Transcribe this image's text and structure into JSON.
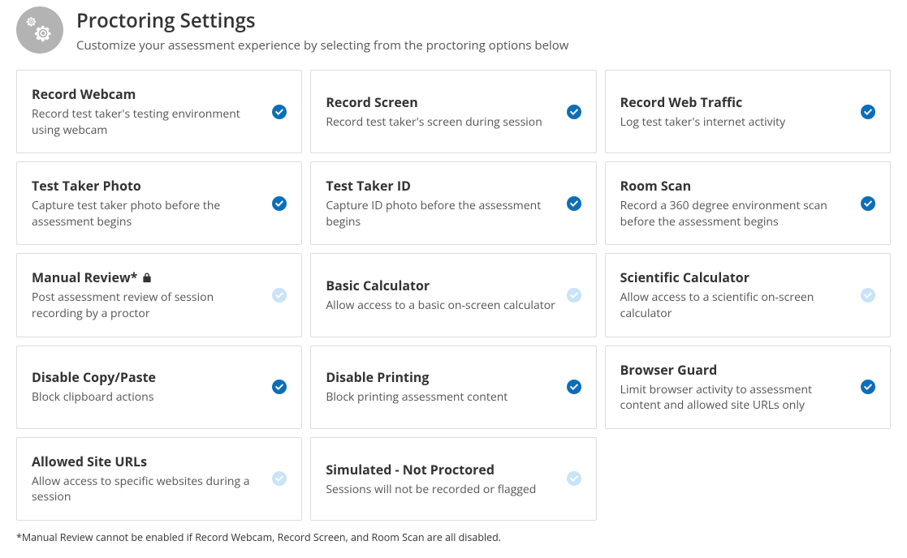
{
  "header": {
    "title": "Proctoring Settings",
    "subtitle": "Customize your assessment experience by selecting from the proctoring options below"
  },
  "cards": [
    {
      "id": "record-webcam",
      "title": "Record Webcam",
      "desc": "Record test taker's testing environment using webcam",
      "enabled": true,
      "locked": false
    },
    {
      "id": "record-screen",
      "title": "Record Screen",
      "desc": "Record test taker's screen during session",
      "enabled": true,
      "locked": false
    },
    {
      "id": "record-web-traffic",
      "title": "Record Web Traffic",
      "desc": "Log test taker's internet activity",
      "enabled": true,
      "locked": false
    },
    {
      "id": "test-taker-photo",
      "title": "Test Taker Photo",
      "desc": "Capture test taker photo before the assessment begins",
      "enabled": true,
      "locked": false
    },
    {
      "id": "test-taker-id",
      "title": "Test Taker ID",
      "desc": "Capture ID photo before the assessment begins",
      "enabled": true,
      "locked": false
    },
    {
      "id": "room-scan",
      "title": "Room Scan",
      "desc": "Record a 360 degree environment scan before the assessment begins",
      "enabled": true,
      "locked": false
    },
    {
      "id": "manual-review",
      "title": "Manual Review*",
      "desc": "Post assessment review of session recording by a proctor",
      "enabled": false,
      "locked": true
    },
    {
      "id": "basic-calculator",
      "title": "Basic Calculator",
      "desc": "Allow access to a basic on-screen calculator",
      "enabled": false,
      "locked": false
    },
    {
      "id": "scientific-calculator",
      "title": "Scientific Calculator",
      "desc": "Allow access to a scientific on-screen calculator",
      "enabled": false,
      "locked": false
    },
    {
      "id": "disable-copy-paste",
      "title": "Disable Copy/Paste",
      "desc": "Block clipboard actions",
      "enabled": true,
      "locked": false
    },
    {
      "id": "disable-printing",
      "title": "Disable Printing",
      "desc": "Block printing assessment content",
      "enabled": true,
      "locked": false
    },
    {
      "id": "browser-guard",
      "title": "Browser Guard",
      "desc": "Limit browser activity to assessment content and allowed site URLs only",
      "enabled": true,
      "locked": false
    },
    {
      "id": "allowed-site-urls",
      "title": "Allowed Site URLs",
      "desc": "Allow access to specific websites during a session",
      "enabled": false,
      "locked": false
    },
    {
      "id": "simulated-not-proctored",
      "title": "Simulated - Not Proctored",
      "desc": "Sessions will not be recorded or flagged",
      "enabled": false,
      "locked": false
    }
  ],
  "footnote": "*Manual Review cannot be enabled if Record Webcam, Record Screen, and Room Scan are all disabled."
}
